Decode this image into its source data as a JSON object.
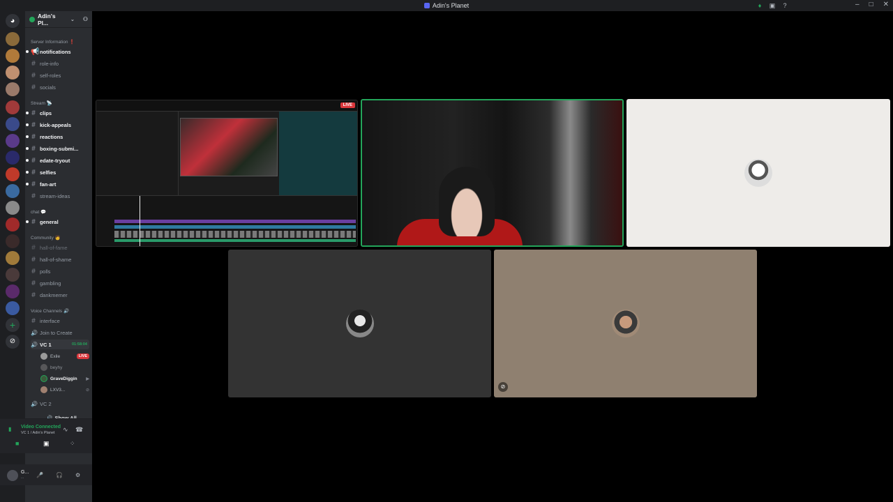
{
  "window": {
    "title": "Adin's Planet"
  },
  "server": {
    "name": "Adin's Pl...",
    "chevron": "⌄"
  },
  "categories": {
    "server_information": "Server Information ❗",
    "stream": "Stream 📡",
    "chat": "chat 💬",
    "community": "Community 🧑",
    "voice_channels": "Voice Channels 🔊"
  },
  "channels": {
    "notifications": "notifications",
    "role_info": "role-info",
    "self_roles": "self-roles",
    "socials": "socials",
    "clips": "clips",
    "kick_appeals": "kick-appeals",
    "reactions": "reactions",
    "boxing_submi": "boxing-submi...",
    "edate_tryout": "edate-tryout",
    "selfies": "selfies",
    "fan_art": "fan-art",
    "stream_ideas": "stream-ideas",
    "general": "general",
    "hall_of_fame": "hall-of-fame",
    "hall_of_shame": "hall-of-shame",
    "polls": "polls",
    "gambling": "gambling",
    "dankmemer": "dankmemer",
    "interface": "interface",
    "join_to_create": "Join to Create",
    "vc1": "VC 1",
    "vc1_timer": "01:58:04",
    "vc2": "VC 2"
  },
  "voice_users": [
    {
      "name": "Exile",
      "live": "LIVE"
    },
    {
      "name": "beyhy",
      "live": ""
    },
    {
      "name": "GraveDiggin",
      "live": ""
    },
    {
      "name": "LXV3...",
      "live": ""
    }
  ],
  "show_all": "Show All",
  "voice_connection": {
    "title": "Video Connected",
    "subtitle": "VC 1 / Adin's Planet"
  },
  "user_panel": {
    "name": "G...",
    "status": "..."
  },
  "stage": {
    "live_badge": "LIVE"
  },
  "icons": {
    "home": "discord-icon",
    "add": "add-server-icon",
    "discover": "discover-icon"
  },
  "colors": {
    "accent_green": "#23a55a",
    "live_red": "#da373c"
  }
}
